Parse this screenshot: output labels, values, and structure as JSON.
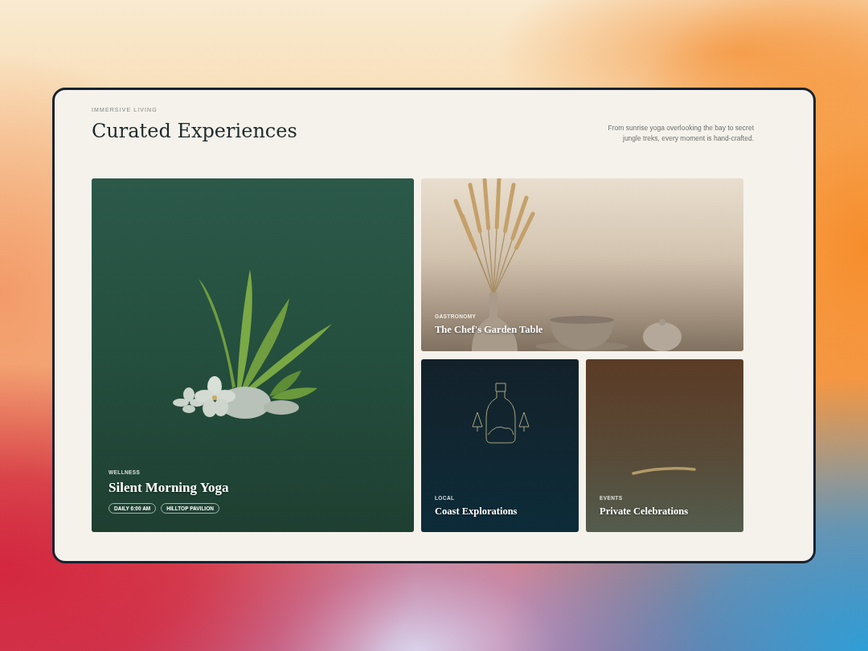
{
  "header": {
    "eyebrow": "IMMERSIVE LIVING",
    "title": "Curated Experiences",
    "description": "From sunrise yoga overlooking the bay to secret jungle treks, every moment is hand-crafted."
  },
  "cards": [
    {
      "kind": "tall",
      "category": "WELLNESS",
      "title": "Silent Morning Yoga",
      "tags": [
        "DAILY 6:00 AM",
        "HILLTOP PAVILION"
      ]
    },
    {
      "kind": "wide",
      "category": "GASTRONOMY",
      "title": "The Chef's Garden Table"
    },
    {
      "kind": "small",
      "category": "LOCAL",
      "title": "Coast Explorations"
    },
    {
      "kind": "small",
      "category": "EVENTS",
      "title": "Private Celebrations"
    }
  ]
}
